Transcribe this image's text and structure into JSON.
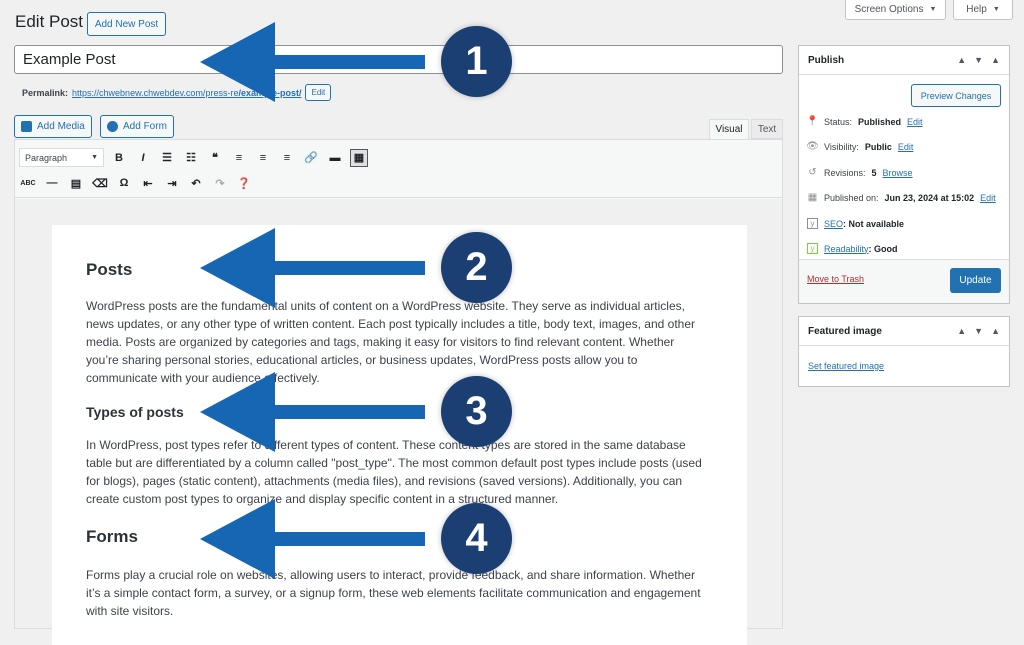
{
  "screen_options": {
    "label": "Screen Options",
    "help_label": "Help"
  },
  "header": {
    "title": "Edit Post",
    "add_new_label": "Add New Post"
  },
  "post": {
    "title": "Example Post"
  },
  "permalink": {
    "label": "Permalink:",
    "url_prefix": "https://chwebnew.chwebdev.com/press-re",
    "url_slug": "/example-post/",
    "edit_label": "Edit"
  },
  "media": {
    "add_media_label": "Add Media",
    "add_form_label": "Add Form"
  },
  "tabs": {
    "visual": "Visual",
    "text": "Text"
  },
  "toolbar": {
    "paragraph_select": "Paragraph"
  },
  "content": {
    "h_posts": "Posts",
    "p_posts_1": "WordPress posts are the fundamental units of content on a WordPress website. They serve as individual articles,",
    "p_posts_2": "news updates, or any other type of written content. Each post typically includes a title, body text, images, and other",
    "p_posts_3": "media. Posts are organized by categories and tags, making it easy for visitors to find relevant content. Whether",
    "p_posts_4": "you’re sharing personal stories, educational articles, or business updates, WordPress posts allow you to",
    "p_posts_5": "communicate with your audience effectively.",
    "h_types": "Types of posts",
    "p_types_1": "In WordPress, post types refer to different types of content. These content types are stored in the same database",
    "p_types_2": "table but are differentiated by a column called \"post_type\". The most common default post types include posts (used",
    "p_types_3": "for blogs), pages (static content), attachments (media files), and revisions (saved versions). Additionally, you can",
    "p_types_4": "create custom post types to organize and display specific content in a structured manner.",
    "h_forms": "Forms",
    "p_forms_1": "Forms play a crucial role on websites, allowing users to interact, provide feedback, and share information. Whether",
    "p_forms_2": "it’s a simple contact form, a survey, or a signup form, these web elements facilitate communication and engagement",
    "p_forms_3": "with site visitors."
  },
  "publish": {
    "title": "Publish",
    "preview_label": "Preview Changes",
    "status_label": "Status:",
    "status_value": "Published",
    "status_edit": "Edit",
    "visibility_label": "Visibility:",
    "visibility_value": "Public",
    "visibility_edit": "Edit",
    "revisions_label": "Revisions:",
    "revisions_value": "5",
    "revisions_browse": "Browse",
    "published_label": "Published on:",
    "published_value": "Jun 23, 2024 at 15:02",
    "published_edit": "Edit",
    "seo_link": "SEO",
    "seo_value": ": Not available",
    "readability_link": "Readability",
    "readability_value": ": Good",
    "trash_label": "Move to Trash",
    "update_label": "Update"
  },
  "featured": {
    "title": "Featured image",
    "set_label": "Set featured image"
  },
  "annotations": {
    "n1": "1",
    "n2": "2",
    "n3": "3",
    "n4": "4"
  }
}
